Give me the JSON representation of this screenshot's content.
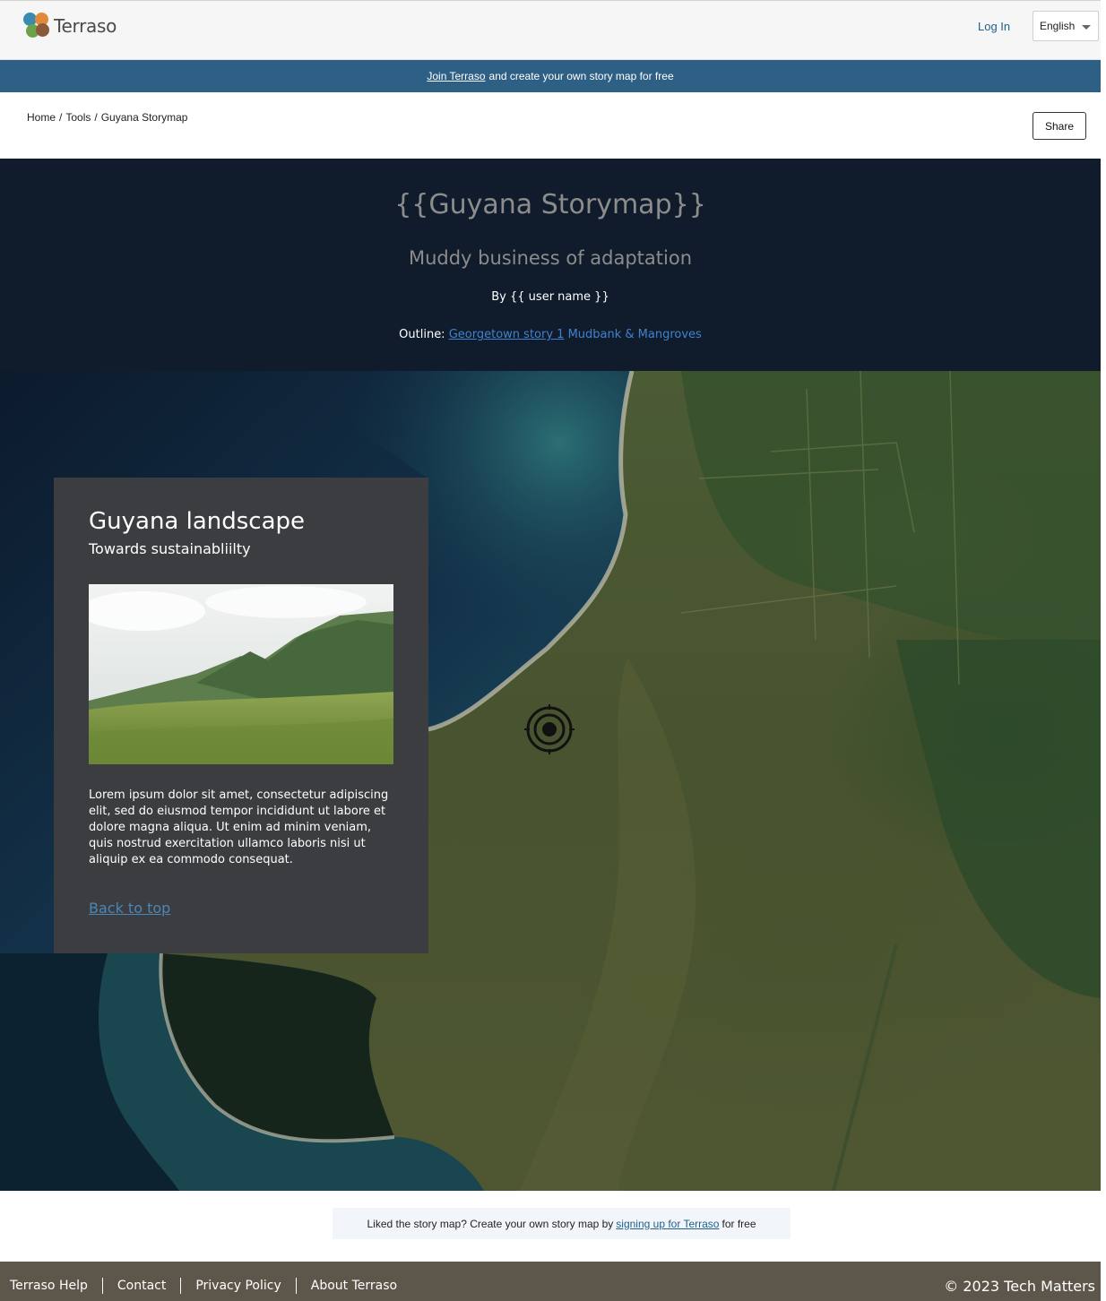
{
  "header": {
    "logo_text": "Terraso",
    "login_label": "Log In",
    "language": "English"
  },
  "join_banner": {
    "link_text": "Join Terraso",
    "rest_text": "and create your own story map for free"
  },
  "breadcrumb": {
    "items": [
      "Home",
      "Tools",
      "Guyana Storymap"
    ]
  },
  "share_label": "Share",
  "story": {
    "title": "{{Guyana Storymap}}",
    "subtitle": "Muddy business of adaptation",
    "byline": "By {{ user name }}",
    "outline_label": "Outline:",
    "outline_link_1": "Georgetown story 1",
    "outline_link_2": "Mudbank & Mangroves"
  },
  "card": {
    "title": "Guyana landscape",
    "subtitle": "Towards sustainabliilty",
    "body": "Lorem ipsum dolor sit amet, consectetur adipiscing elit, sed do eiusmod tempor incididunt ut labore et dolore magna aliqua. Ut enim ad minim veniam, quis nostrud exercitation ullamco laboris nisi ut aliquip ex ea commodo consequat.",
    "back_label": "Back to top"
  },
  "signup": {
    "prefix": "Liked the story map? Create your own story map by",
    "link_text": "signing up for Terraso",
    "suffix": "for free"
  },
  "footer": {
    "links": [
      "Terraso Help",
      "Contact",
      "Privacy Policy",
      "About Terraso"
    ],
    "copyright": "© 2023 Tech Matters"
  },
  "colors": {
    "brand_blue": "#2e5f84",
    "title_bg": "#101c2c",
    "footer_bg": "#5d564b",
    "link": "#3f82cf"
  }
}
